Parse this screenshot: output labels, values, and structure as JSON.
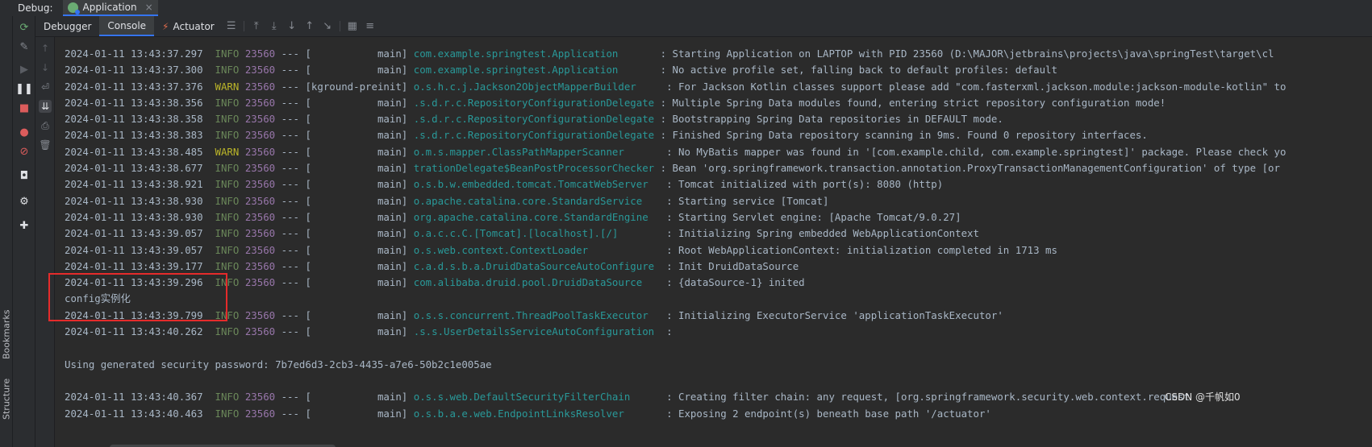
{
  "header": {
    "debug_label": "Debug:",
    "app_tab": "Application",
    "close": "×"
  },
  "side_labels": {
    "bookmarks": "Bookmarks",
    "structure": "Structure"
  },
  "tabs": {
    "debugger": "Debugger",
    "console": "Console",
    "actuator": "Actuator"
  },
  "log": [
    {
      "ts": "2024-01-11 13:43:37.297",
      "lvl": "INFO",
      "pid": "23560",
      "thread": "[           main]",
      "logger": "com.example.springtest.Application      ",
      "msg": ": Starting Application on LAPTOP with PID 23560 (D:\\MAJOR\\jetbrains\\projects\\java\\springTest\\target\\cl"
    },
    {
      "ts": "2024-01-11 13:43:37.300",
      "lvl": "INFO",
      "pid": "23560",
      "thread": "[           main]",
      "logger": "com.example.springtest.Application      ",
      "msg": ": No active profile set, falling back to default profiles: default"
    },
    {
      "ts": "2024-01-11 13:43:37.376",
      "lvl": "WARN",
      "pid": "23560",
      "thread": "[kground-preinit]",
      "logger": "o.s.h.c.j.Jackson2ObjectMapperBuilder    ",
      "msg": ": For Jackson Kotlin classes support please add \"com.fasterxml.jackson.module:jackson-module-kotlin\" to"
    },
    {
      "ts": "2024-01-11 13:43:38.356",
      "lvl": "INFO",
      "pid": "23560",
      "thread": "[           main]",
      "logger": ".s.d.r.c.RepositoryConfigurationDelegate",
      "msg": ": Multiple Spring Data modules found, entering strict repository configuration mode!"
    },
    {
      "ts": "2024-01-11 13:43:38.358",
      "lvl": "INFO",
      "pid": "23560",
      "thread": "[           main]",
      "logger": ".s.d.r.c.RepositoryConfigurationDelegate",
      "msg": ": Bootstrapping Spring Data repositories in DEFAULT mode."
    },
    {
      "ts": "2024-01-11 13:43:38.383",
      "lvl": "INFO",
      "pid": "23560",
      "thread": "[           main]",
      "logger": ".s.d.r.c.RepositoryConfigurationDelegate",
      "msg": ": Finished Spring Data repository scanning in 9ms. Found 0 repository interfaces."
    },
    {
      "ts": "2024-01-11 13:43:38.485",
      "lvl": "WARN",
      "pid": "23560",
      "thread": "[           main]",
      "logger": "o.m.s.mapper.ClassPathMapperScanner      ",
      "msg": ": No MyBatis mapper was found in '[com.example.child, com.example.springtest]' package. Please check yo"
    },
    {
      "ts": "2024-01-11 13:43:38.677",
      "lvl": "INFO",
      "pid": "23560",
      "thread": "[           main]",
      "logger": "trationDelegate$BeanPostProcessorChecker",
      "msg": ": Bean 'org.springframework.transaction.annotation.ProxyTransactionManagementConfiguration' of type [or"
    },
    {
      "ts": "2024-01-11 13:43:38.921",
      "lvl": "INFO",
      "pid": "23560",
      "thread": "[           main]",
      "logger": "o.s.b.w.embedded.tomcat.TomcatWebServer  ",
      "msg": ": Tomcat initialized with port(s): 8080 (http)"
    },
    {
      "ts": "2024-01-11 13:43:38.930",
      "lvl": "INFO",
      "pid": "23560",
      "thread": "[           main]",
      "logger": "o.apache.catalina.core.StandardService   ",
      "msg": ": Starting service [Tomcat]"
    },
    {
      "ts": "2024-01-11 13:43:38.930",
      "lvl": "INFO",
      "pid": "23560",
      "thread": "[           main]",
      "logger": "org.apache.catalina.core.StandardEngine  ",
      "msg": ": Starting Servlet engine: [Apache Tomcat/9.0.27]"
    },
    {
      "ts": "2024-01-11 13:43:39.057",
      "lvl": "INFO",
      "pid": "23560",
      "thread": "[           main]",
      "logger": "o.a.c.c.C.[Tomcat].[localhost].[/]       ",
      "msg": ": Initializing Spring embedded WebApplicationContext"
    },
    {
      "ts": "2024-01-11 13:43:39.057",
      "lvl": "INFO",
      "pid": "23560",
      "thread": "[           main]",
      "logger": "o.s.web.context.ContextLoader            ",
      "msg": ": Root WebApplicationContext: initialization completed in 1713 ms"
    },
    {
      "ts": "2024-01-11 13:43:39.177",
      "lvl": "INFO",
      "pid": "23560",
      "thread": "[           main]",
      "logger": "c.a.d.s.b.a.DruidDataSourceAutoConfigure ",
      "msg": ": Init DruidDataSource"
    },
    {
      "ts": "2024-01-11 13:43:39.296",
      "lvl": "INFO",
      "pid": "23560",
      "thread": "[           main]",
      "logger": "com.alibaba.druid.pool.DruidDataSource   ",
      "msg": ": {dataSource-1} inited"
    },
    {
      "plain": "config实例化"
    },
    {
      "ts": "2024-01-11 13:43:39.799",
      "lvl": "INFO",
      "pid": "23560",
      "thread": "[           main]",
      "logger": "o.s.s.concurrent.ThreadPoolTaskExecutor  ",
      "msg": ": Initializing ExecutorService 'applicationTaskExecutor'"
    },
    {
      "ts": "2024-01-11 13:43:40.262",
      "lvl": "INFO",
      "pid": "23560",
      "thread": "[           main]",
      "logger": ".s.s.UserDetailsServiceAutoConfiguration ",
      "msg": ":"
    },
    {
      "plain": ""
    },
    {
      "plain": "Using generated security password: 7b7ed6d3-2cb3-4435-a7e6-50b2c1e005ae"
    },
    {
      "plain": ""
    },
    {
      "ts": "2024-01-11 13:43:40.367",
      "lvl": "INFO",
      "pid": "23560",
      "thread": "[           main]",
      "logger": "o.s.s.web.DefaultSecurityFilterChain     ",
      "msg": ": Creating filter chain: any request, [org.springframework.security.web.context.request"
    },
    {
      "ts": "2024-01-11 13:43:40.463",
      "lvl": "INFO",
      "pid": "23560",
      "thread": "[           main]",
      "logger": "o.s.b.a.e.web.EndpointLinksResolver      ",
      "msg": ": Exposing 2 endpoint(s) beneath base path '/actuator'"
    }
  ],
  "watermark": "CSDN @千帆如0",
  "colors": {
    "info": "#6a8759",
    "warn": "#bbb529",
    "pid": "#9876aa",
    "logger": "#299999",
    "highlight": "#e52b2b"
  }
}
